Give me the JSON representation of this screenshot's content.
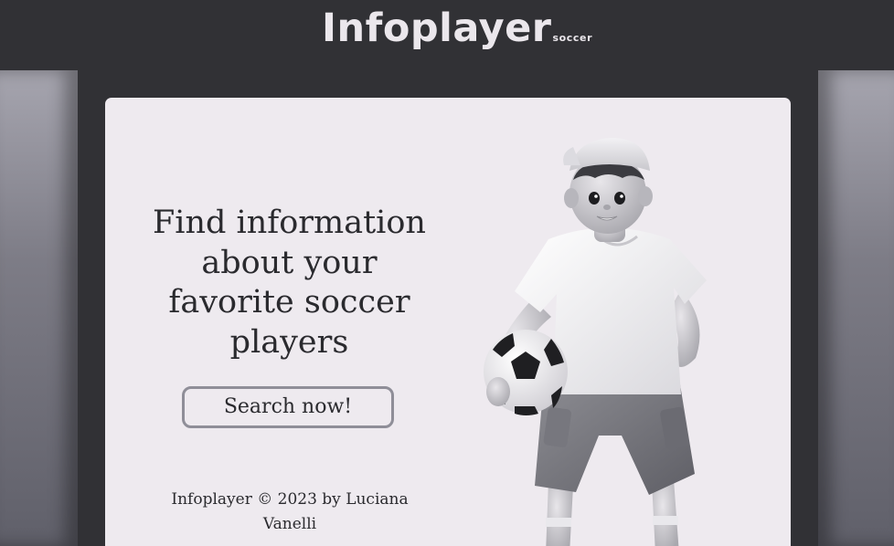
{
  "header": {
    "logo_main": "Infoplayer",
    "logo_sub": "soccer"
  },
  "hero": {
    "headline": "Find information about your favorite soccer players",
    "cta_label": "Search now!",
    "illustration_icon": "boy-with-soccer-ball-illustration"
  },
  "footer": {
    "text": "Infoplayer © 2023 by Luciana Vanelli"
  },
  "colors": {
    "header_bg": "#313135",
    "card_bg": "#eeeaef",
    "text": "#2a2a2e",
    "button_border": "#8f8e98",
    "logo": "#ebe7ec"
  }
}
